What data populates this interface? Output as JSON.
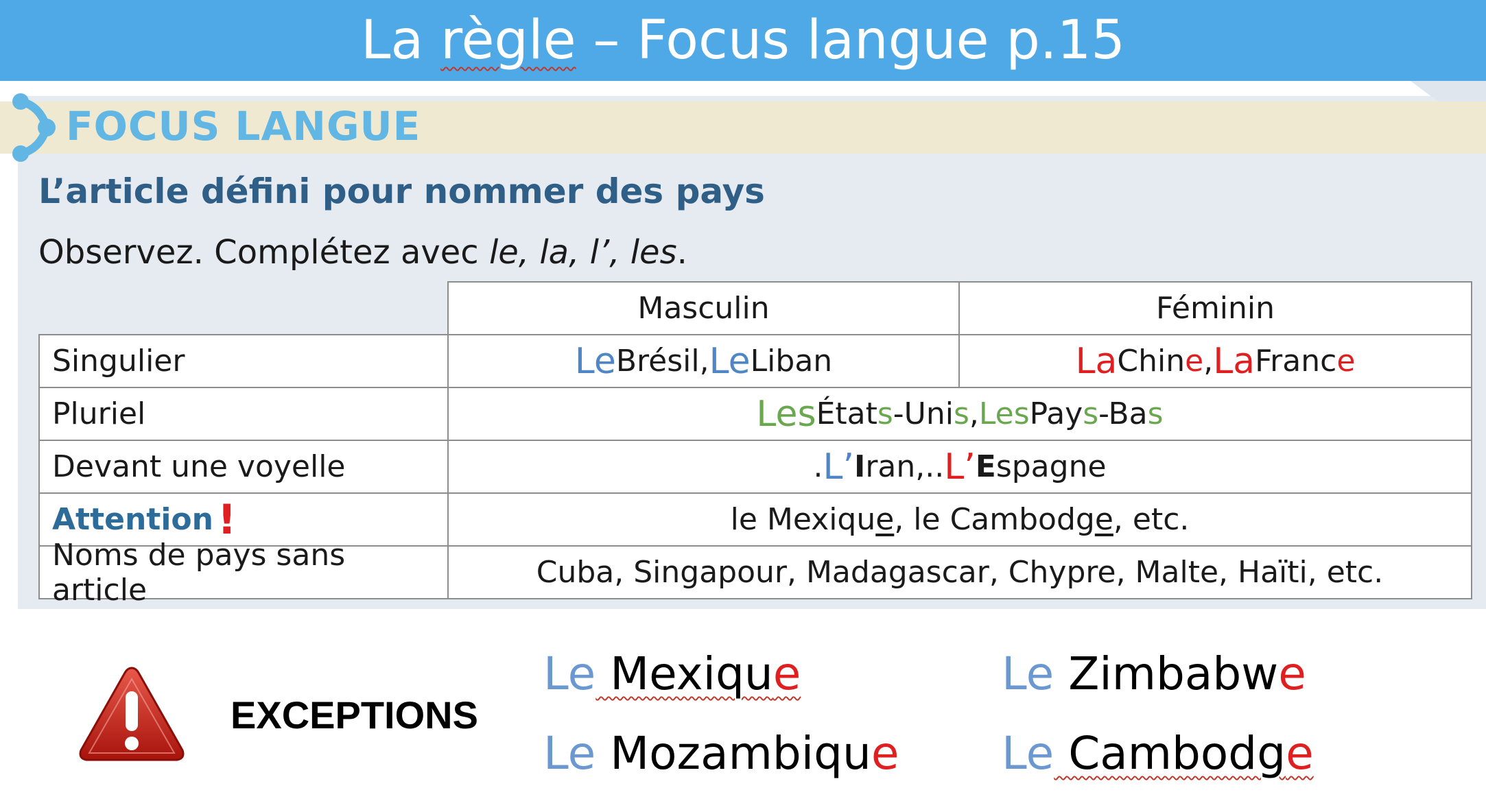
{
  "title": {
    "before": "La ",
    "word": "règle",
    "after": " – Focus langue p.15"
  },
  "focus": {
    "heading": "FOCUS LANGUE",
    "subtitle": "L’article défini pour nommer des pays",
    "instruction": "Observez. Complétez avec ",
    "instruction_italic": "le, la, l’, les",
    "instruction_end": "."
  },
  "table": {
    "headers": {
      "masculin": "Masculin",
      "feminin": "Féminin"
    },
    "rows": {
      "singulier": {
        "label": "Singulier",
        "masc": {
          "a1": "Le",
          "t1": " Brésil, ",
          "a2": "Le",
          "t2": " Liban"
        },
        "fem": {
          "a1": "La",
          "t1": " Chin",
          "e1": "e",
          "t2": ", ",
          "a2": "La",
          "t3": " Franc",
          "e2": "e"
        }
      },
      "pluriel": {
        "label": "Pluriel",
        "a1": "Les",
        "t1": " État",
        "s1": "s",
        "t2": "-Uni",
        "s2": "s",
        "comma": ",",
        "a2": "Les",
        "t3": " Pay",
        "s3": "s",
        "t4": "-Ba",
        "s4": "s"
      },
      "voyelle": {
        "label": "Devant une voyelle",
        "d1": ".",
        "a1": "L’",
        "v1": " I",
        "t1": "ran, ",
        "d2": "..",
        "a2": "L’",
        "v2": " E",
        "t2": "spagne"
      },
      "attention": {
        "label": "Attention",
        "mark": "!",
        "t1": "le Mexiqu",
        "e1": "e",
        "t2": ", le Cambodg",
        "e2": "e",
        "t3": ", etc."
      },
      "sans_article": {
        "label": "Noms de pays sans article",
        "value": "Cuba, Singapour, Madagascar, Chypre, Malte, Haïti, etc."
      }
    }
  },
  "exceptions": {
    "label": "EXCEPTIONS",
    "items": [
      {
        "article": "Le",
        "stem": " Mexiqu",
        "ending": "e"
      },
      {
        "article": "Le",
        "stem": " Zimbabw",
        "ending": "e"
      },
      {
        "article": "Le",
        "stem": " Mozambiqu",
        "ending": "e"
      },
      {
        "article": "Le",
        "stem": " Cambodg",
        "ending": "e"
      }
    ]
  },
  "colors": {
    "title_bar": "#4fa9e6",
    "focus_blue": "#62b6e3",
    "subtitle": "#2f5f86",
    "masculine": "#4f86c6",
    "feminine": "#e02020",
    "plural": "#6aa84f"
  },
  "icons": [
    "focus-langue-logo-icon",
    "warning-triangle-icon",
    "exclamation-icon"
  ]
}
